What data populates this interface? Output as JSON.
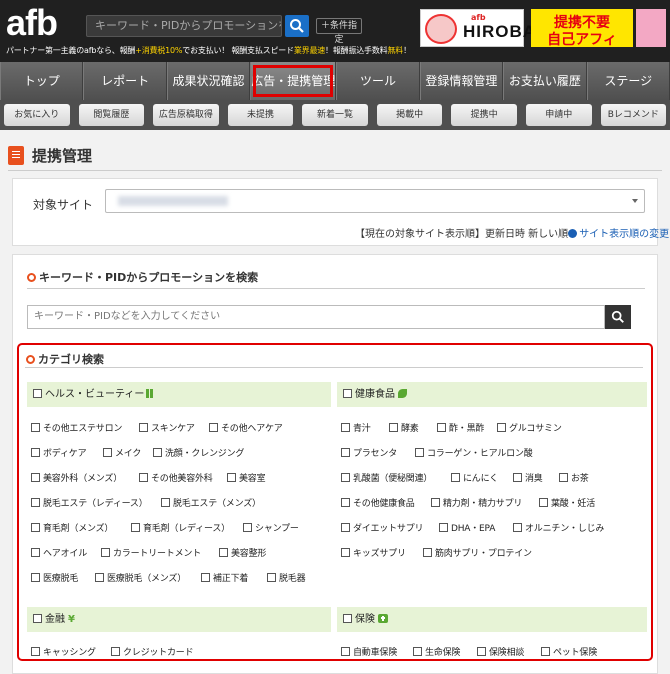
{
  "header": {
    "logo": "afb",
    "search_placeholder": "キーワード・PIDからプロモーションを検索",
    "condition_button": "＋条件指定",
    "tagline_1": "パートナー第一主義のafbなら、報酬",
    "tagline_hl_1": "+消費税10%",
    "tagline_2": "でお支払い！ 報酬支払スピード",
    "tagline_hl_2": "業界最速",
    "tagline_3": "！報酬振込手数料",
    "tagline_hl_3": "無料",
    "tagline_4": "！",
    "banner_hiroba_small": "afb",
    "banner_hiroba": "HIROBA",
    "banner_promo_line1": "提携不要",
    "banner_promo_line2": "自己アフィ"
  },
  "nav_main": [
    "トップ",
    "レポート",
    "成果状況確認",
    "広告・提携管理",
    "ツール",
    "登録情報管理",
    "お支払い履歴",
    "ステージ"
  ],
  "nav_sub": [
    "お気に入り",
    "閲覧履歴",
    "広告原稿取得",
    "未提携",
    "新着一覧",
    "掲載中",
    "提携中",
    "申請中",
    "Bレコメンド"
  ],
  "page": {
    "title": "提携管理"
  },
  "site": {
    "label": "対象サイト",
    "order_text": "【現在の対象サイト表示順】更新日時 新しい順",
    "order_link": "サイト表示順の変更"
  },
  "keyword": {
    "heading": "キーワード・PIDからプロモーションを検索",
    "placeholder": "キーワード・PIDなどを入力してください"
  },
  "category": {
    "heading": "カテゴリ検索",
    "groups": {
      "health": {
        "label": "ヘルス・ビューティー",
        "options": [
          "その他エステサロン",
          "スキンケア",
          "その他ヘアケア",
          "ボディケア",
          "メイク",
          "洗顔・クレンジング",
          "美容外科（メンズ）",
          "その他美容外科",
          "美容室",
          "脱毛エステ（レディース）",
          "脱毛エステ（メンズ）",
          "育毛剤（メンズ）",
          "育毛剤（レディース）",
          "シャンプー",
          "ヘアオイル",
          "カラートリートメント",
          "美容整形",
          "医療脱毛",
          "医療脱毛（メンズ）",
          "補正下着",
          "脱毛器"
        ]
      },
      "food": {
        "label": "健康食品",
        "options": [
          "青汁",
          "酵素",
          "酢・黒酢",
          "グルコサミン",
          "プラセンタ",
          "コラーゲン・ヒアルロン酸",
          "乳酸菌（便秘関連）",
          "にんにく",
          "消臭",
          "お茶",
          "その他健康食品",
          "精力剤・精力サプリ",
          "葉酸・妊活",
          "ダイエットサプリ",
          "DHA・EPA",
          "オルニチン・しじみ",
          "キッズサプリ",
          "筋肉サプリ・プロテイン"
        ]
      },
      "finance": {
        "label": "金融",
        "options": [
          "キャッシング",
          "クレジットカード"
        ]
      },
      "insurance": {
        "label": "保険",
        "options": [
          "自動車保険",
          "生命保険",
          "保険相談",
          "ペット保険"
        ]
      }
    }
  }
}
